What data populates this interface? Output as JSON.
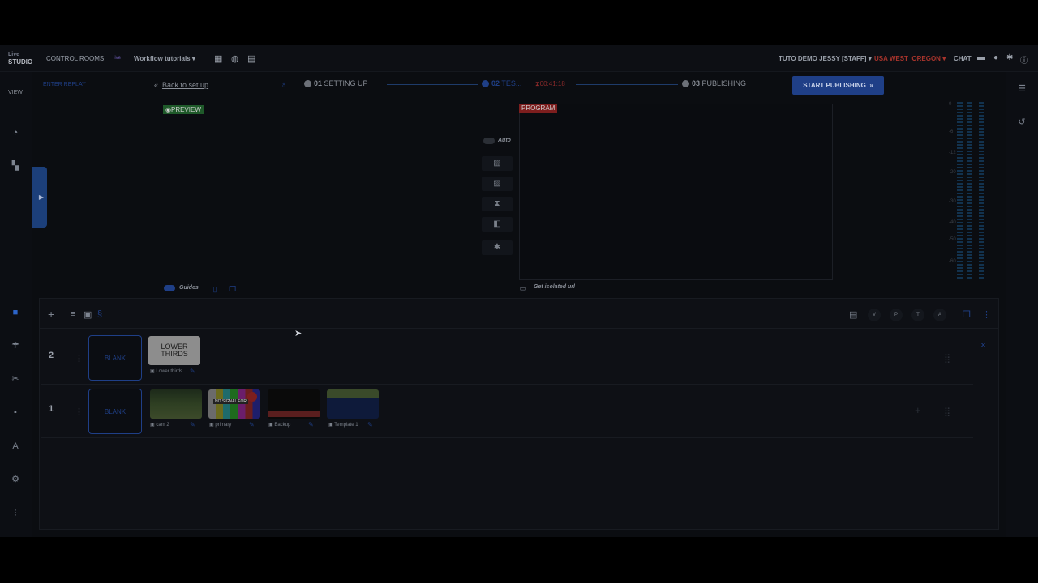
{
  "topbar": {
    "logo_top": "Live",
    "logo_bottom": "STUDIO",
    "control_rooms": "CONTROL ROOMS",
    "live_badge": "live",
    "workflow": "Workflow tutorials",
    "user": "TUTO DEMO JESSY [STAFF]",
    "region": "USA WEST",
    "region_sub": "OREGON",
    "chat": "CHAT"
  },
  "leftrail": {
    "view_label": "VIEW"
  },
  "header": {
    "enter_replay": "ENTER REPLAY",
    "back_link": "Back to set up",
    "steps": [
      {
        "num": "01",
        "label": "SETTING UP"
      },
      {
        "num": "02",
        "label": "TES..."
      },
      {
        "num": "03",
        "label": "PUBLISHING"
      }
    ],
    "timer": "00:41:18",
    "publish_button": "START PUBLISHING",
    "accent": "#1f3f87"
  },
  "preview": {
    "tag": "PREVIEW",
    "guides_label": "Guides"
  },
  "program": {
    "tag": "PROGRAM",
    "isolated_url": "Get isolated url"
  },
  "switcher": {
    "auto_label": "Auto"
  },
  "meters": {
    "labels": [
      "0",
      "-6",
      "-12",
      "-20",
      "-30",
      "-40",
      "-50",
      "-60"
    ]
  },
  "toolbar": {
    "circle_buttons": [
      "V",
      "P",
      "T",
      "A"
    ]
  },
  "layers": [
    {
      "number": "2",
      "blank_label": "BLANK",
      "items": [
        {
          "name": "Lower thirds",
          "thumb_text": "LOWER THIRDS"
        }
      ]
    },
    {
      "number": "1",
      "blank_label": "BLANK",
      "items": [
        {
          "name": "cam 2"
        },
        {
          "name": "primary",
          "thumb_text": "NO SIGNAL FOR"
        },
        {
          "name": "Backup"
        },
        {
          "name": "Template 1"
        }
      ]
    }
  ]
}
